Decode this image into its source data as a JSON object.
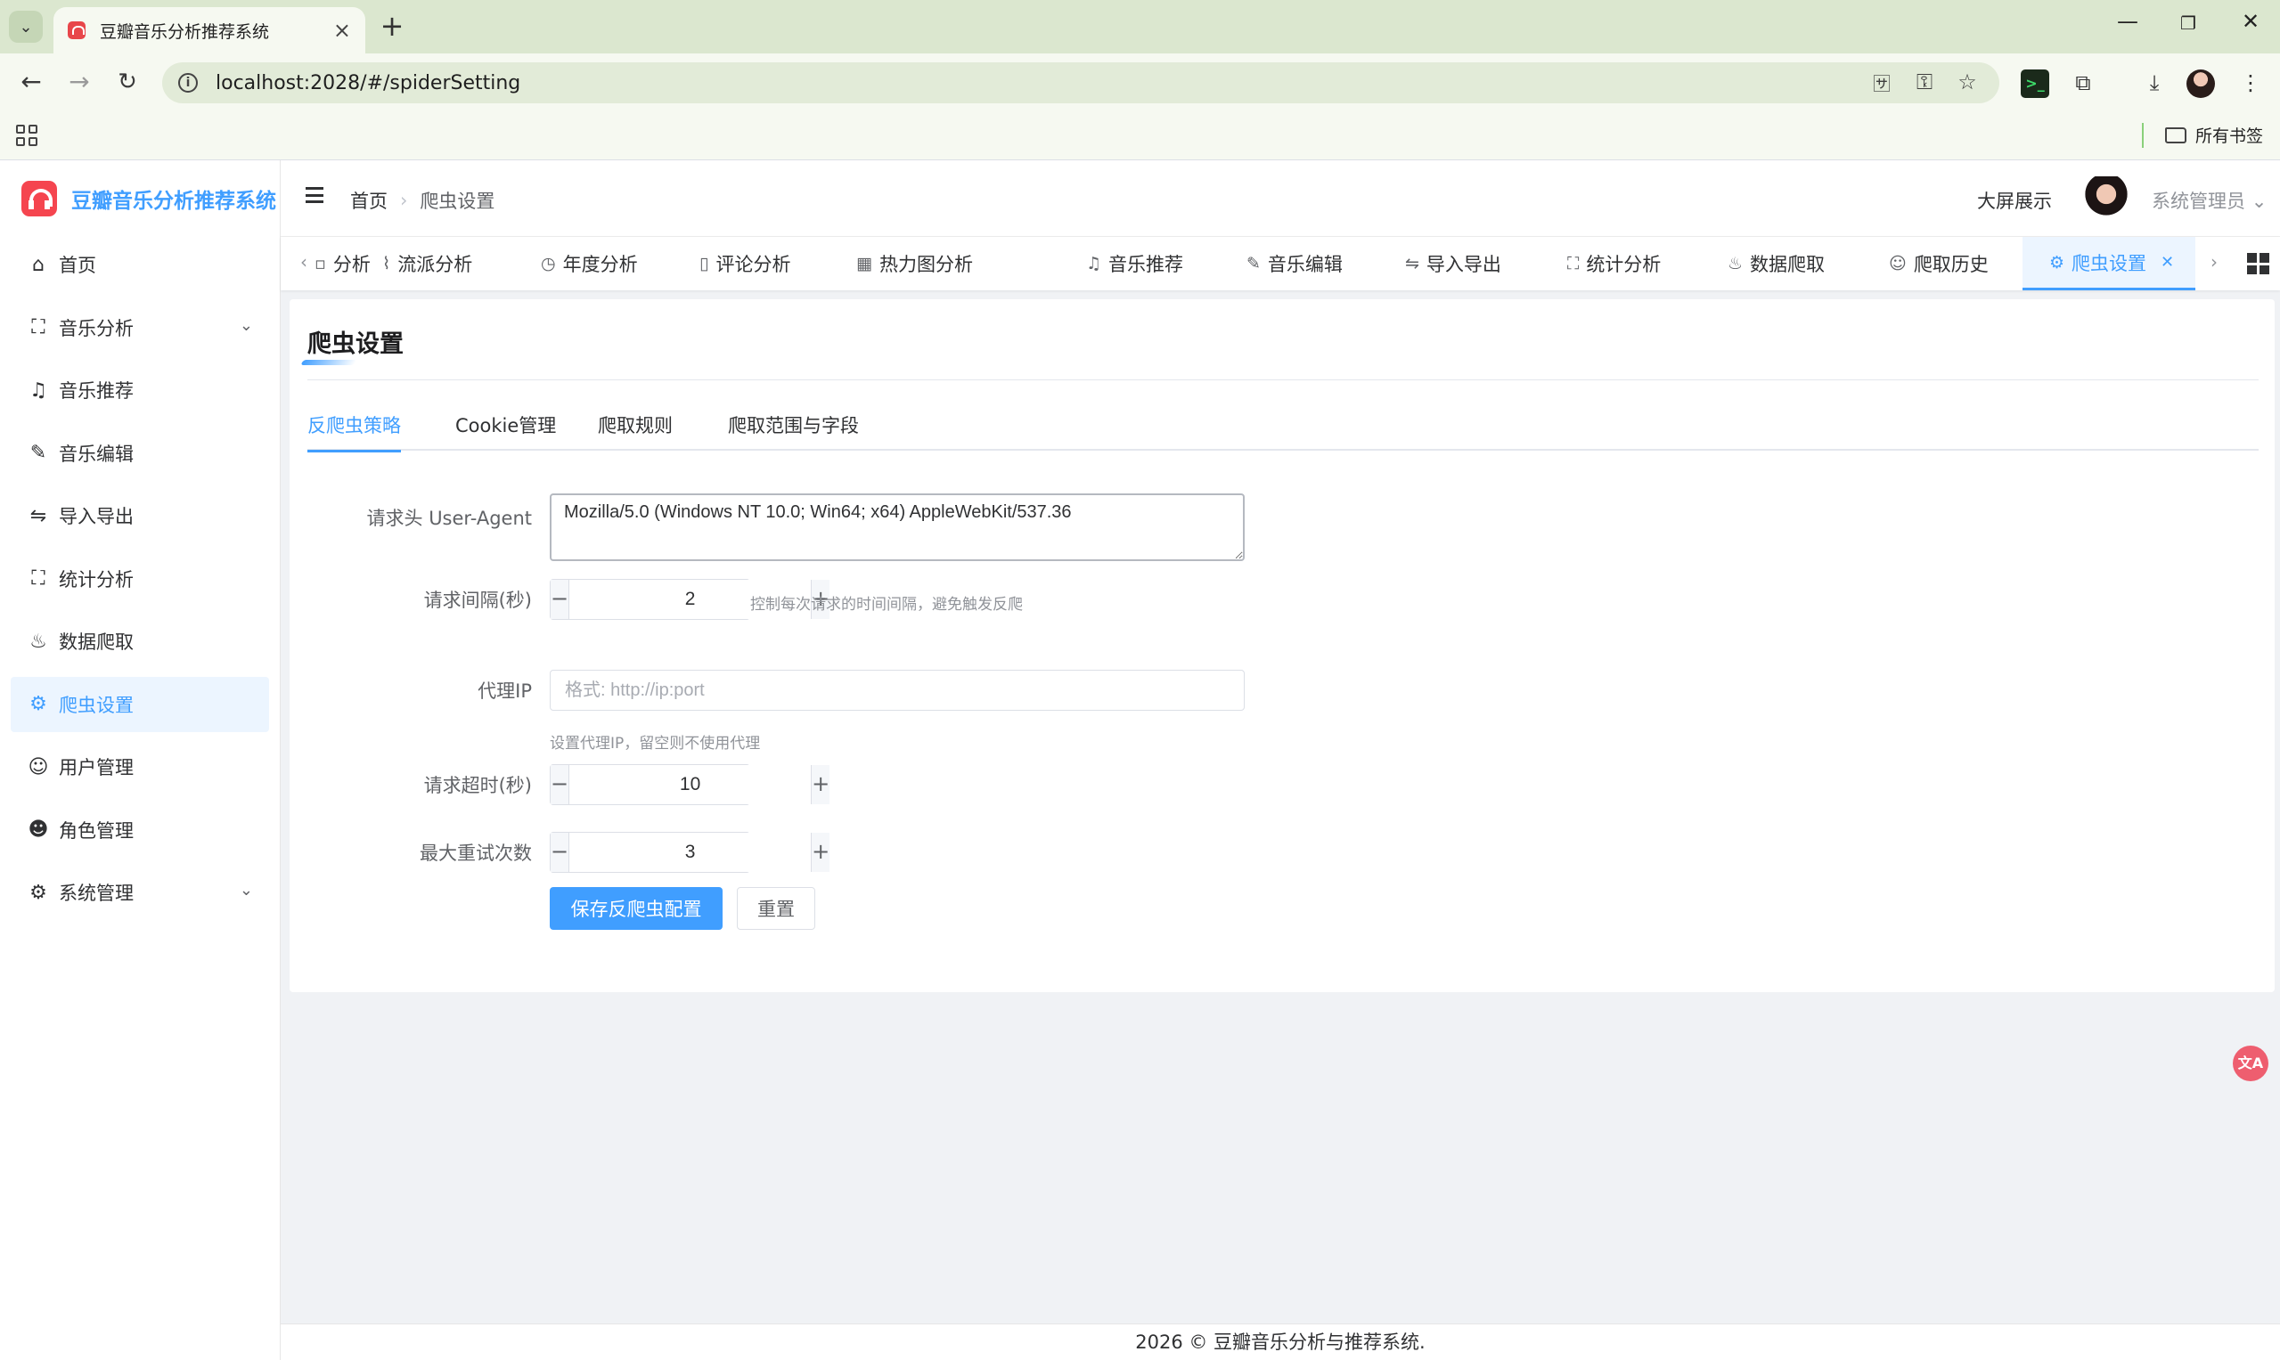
{
  "browser": {
    "tab_title": "豆瓣音乐分析推荐系统",
    "url": "localhost:2028/#/spiderSetting",
    "bookmarks_label": "所有书签"
  },
  "app": {
    "logo_text": "豆瓣音乐分析推荐系统",
    "breadcrumb": {
      "home": "首页",
      "current": "爬虫设置"
    },
    "nav_screen": "大屏展示",
    "user_name": "系统管理员",
    "footer": "2026 © 豆瓣音乐分析与推荐系统."
  },
  "sidebar": {
    "items": [
      {
        "label": "首页",
        "icon": "home-icon"
      },
      {
        "label": "音乐分析",
        "icon": "presentation-icon",
        "has_children": true
      },
      {
        "label": "音乐推荐",
        "icon": "headset-icon"
      },
      {
        "label": "音乐编辑",
        "icon": "edit-pen-icon"
      },
      {
        "label": "导入导出",
        "icon": "switch-icon"
      },
      {
        "label": "统计分析",
        "icon": "presentation-icon"
      },
      {
        "label": "数据爬取",
        "icon": "bowl-icon"
      },
      {
        "label": "爬虫设置",
        "icon": "setting-icon",
        "active": true
      },
      {
        "label": "用户管理",
        "icon": "user-icon"
      },
      {
        "label": "角色管理",
        "icon": "user-filled-icon"
      },
      {
        "label": "系统管理",
        "icon": "setting-icon",
        "has_children": true
      }
    ]
  },
  "tags": [
    {
      "label": "分析",
      "icon": "presentation-icon"
    },
    {
      "label": "流派分析",
      "icon": "paperclip-icon"
    },
    {
      "label": "年度分析",
      "icon": "clock-icon"
    },
    {
      "label": "评论分析",
      "icon": "notebook-icon"
    },
    {
      "label": "热力图分析",
      "icon": "grid-icon"
    },
    {
      "label": "音乐推荐",
      "icon": "headset-icon"
    },
    {
      "label": "音乐编辑",
      "icon": "edit-pen-icon"
    },
    {
      "label": "导入导出",
      "icon": "switch-icon"
    },
    {
      "label": "统计分析",
      "icon": "presentation-icon"
    },
    {
      "label": "数据爬取",
      "icon": "bowl-icon"
    },
    {
      "label": "爬取历史",
      "icon": "user-icon"
    },
    {
      "label": "爬虫设置",
      "icon": "setting-icon",
      "active": true
    }
  ],
  "page": {
    "title": "爬虫设置",
    "tabs": [
      "反爬虫策略",
      "Cookie管理",
      "爬取规则",
      "爬取范围与字段"
    ],
    "active_tab": "反爬虫策略"
  },
  "form": {
    "user_agent": {
      "label": "请求头 User-Agent",
      "value": "Mozilla/5.0 (Windows NT 10.0; Win64; x64) AppleWebKit/537.36"
    },
    "interval": {
      "label": "请求间隔(秒)",
      "value": "2",
      "hint": "控制每次请求的时间间隔，避免触发反爬"
    },
    "proxy": {
      "label": "代理IP",
      "value": "",
      "placeholder": "格式: http://ip:port",
      "hint": "设置代理IP，留空则不使用代理"
    },
    "timeout": {
      "label": "请求超时(秒)",
      "value": "10"
    },
    "retries": {
      "label": "最大重试次数",
      "value": "3"
    },
    "save_label": "保存反爬虫配置",
    "reset_label": "重置"
  }
}
